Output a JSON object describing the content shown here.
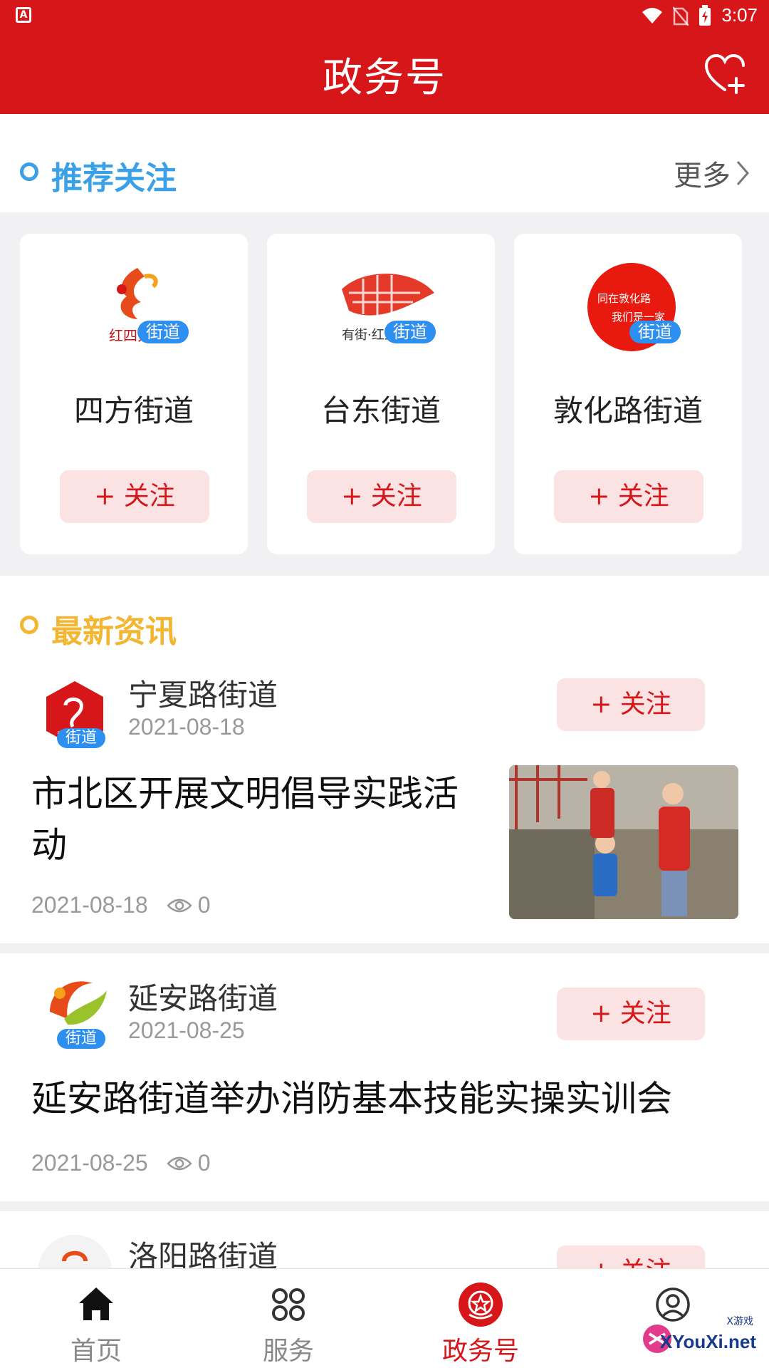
{
  "status": {
    "time": "3:07"
  },
  "header": {
    "title": "政务号"
  },
  "recommend": {
    "title": "推荐关注",
    "more": "更多",
    "cards": [
      {
        "name": "四方街道",
        "badge": "街道",
        "follow": "+ 关注"
      },
      {
        "name": "台东街道",
        "badge": "街道",
        "follow": "+ 关注"
      },
      {
        "name": "敦化路街道",
        "badge": "街道",
        "follow": "+ 关注"
      }
    ]
  },
  "latest": {
    "title": "最新资讯",
    "items": [
      {
        "source": "宁夏路街道",
        "source_date": "2021-08-18",
        "badge": "街道",
        "follow": "+ 关注",
        "headline_line1": "市北区开展文明倡导实践活",
        "headline_line2": "动",
        "date": "2021-08-18",
        "views": "0"
      },
      {
        "source": "延安路街道",
        "source_date": "2021-08-25",
        "badge": "街道",
        "follow": "+ 关注",
        "headline_line1": "延安路街道举办消防基本技能实操实训会",
        "date": "2021-08-25",
        "views": "0"
      },
      {
        "source": "洛阳路街道",
        "follow": "+ 关注"
      }
    ]
  },
  "nav": [
    {
      "label": "首页",
      "icon": "home-icon"
    },
    {
      "label": "服务",
      "icon": "grid-icon"
    },
    {
      "label": "政务号",
      "icon": "emblem-icon",
      "active": true
    },
    {
      "label": "",
      "icon": "user-icon"
    }
  ],
  "watermark": {
    "text": "XYouXi.net",
    "sub": "X游戏"
  },
  "colors": {
    "primary": "#d7161a",
    "recommend_accent": "#3aa0e8",
    "latest_accent": "#f2b632",
    "badge": "#2d8ff0"
  }
}
